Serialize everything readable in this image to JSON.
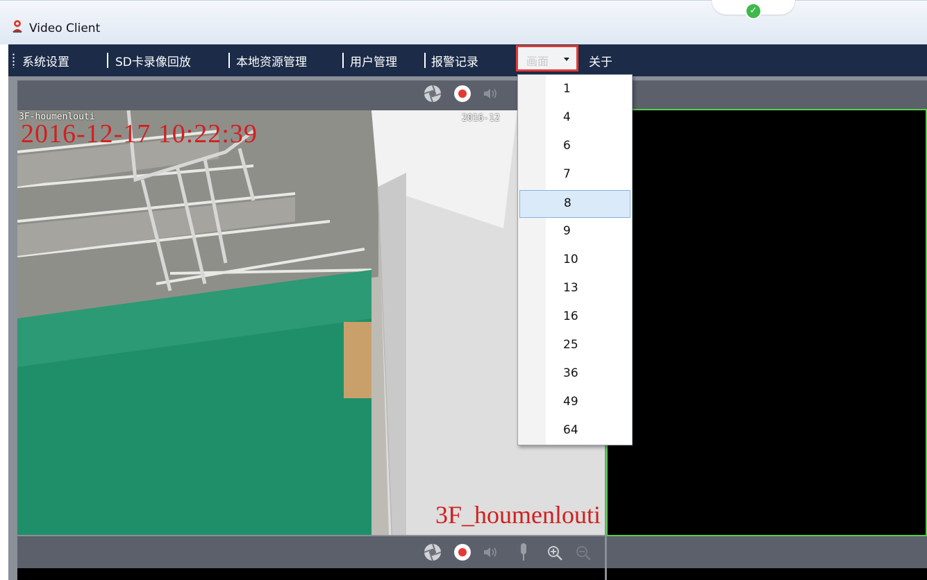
{
  "window": {
    "title": "Video Client"
  },
  "menubar": {
    "items": [
      {
        "label": "系统设置"
      },
      {
        "label": "SD卡录像回放"
      },
      {
        "label": "本地资源管理"
      },
      {
        "label": "用户管理"
      },
      {
        "label": "报警记录"
      }
    ],
    "screen_menu": {
      "label": "画面"
    },
    "about": {
      "label": "关于"
    }
  },
  "dropdown": {
    "options": [
      "1",
      "4",
      "6",
      "7",
      "8",
      "9",
      "10",
      "13",
      "16",
      "25",
      "36",
      "49",
      "64"
    ],
    "selected": "8"
  },
  "video": {
    "osd_channel": "3F-houmenlouti",
    "osd_timestamp": "2016-12-17 10:22:39",
    "osd_small_time": "2016-12",
    "camera_name": "3F_houmenlouti"
  },
  "colors": {
    "menubar_bg": "#1b2b48",
    "highlight_border": "#e53935",
    "active_pane_border": "#55d04a",
    "osd_text": "#d02020",
    "selection_bg": "#dbeaf8"
  },
  "icons": [
    "app-logo-icon",
    "status-check-icon",
    "snapshot-icon",
    "record-icon",
    "audio-icon",
    "microphone-icon",
    "zoom-in-icon",
    "zoom-out-icon",
    "chevron-down-icon"
  ]
}
